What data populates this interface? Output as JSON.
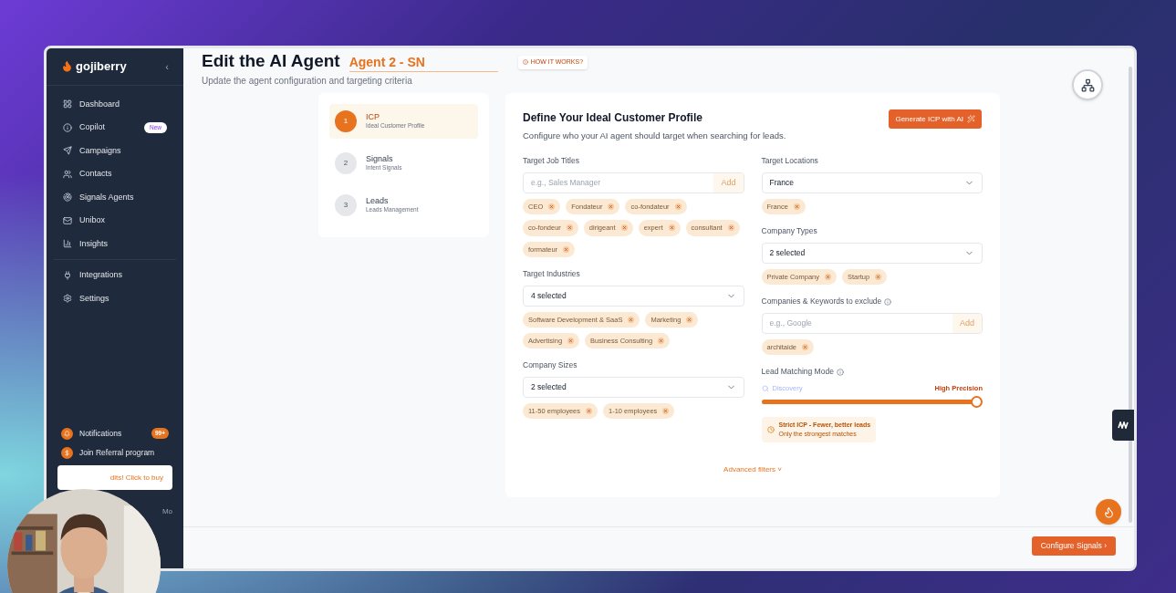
{
  "sidebar": {
    "brand": "gojiberry",
    "collapse": "‹",
    "items": [
      {
        "label": "Dashboard",
        "selected": false
      },
      {
        "label": "Copilot",
        "badge": "New",
        "selected": false
      },
      {
        "label": "Campaigns",
        "selected": false
      },
      {
        "label": "Contacts",
        "selected": false
      },
      {
        "label": "Signals Agents",
        "selected": false
      },
      {
        "label": "Unibox",
        "selected": false
      },
      {
        "label": "Insights",
        "selected": false
      },
      {
        "label": "Integrations",
        "selected": false
      },
      {
        "label": "Settings",
        "selected": false
      }
    ],
    "footer": [
      {
        "label": "Notifications",
        "badge": "99+"
      },
      {
        "label": "Join Referral program"
      }
    ],
    "credits": "dits! Click to buy",
    "user": "Mo"
  },
  "header": {
    "title": "Edit the AI Agent",
    "agent_name": "Agent 2 - SN",
    "help": "HOW IT WORKS?",
    "subtitle": "Update the agent configuration and targeting criteria"
  },
  "steps": [
    {
      "number": "1",
      "title": "ICP",
      "subtitle": "Ideal Customer Profile",
      "selected": true
    },
    {
      "number": "2",
      "title": "Signals",
      "subtitle": "Intent Signals",
      "selected": false
    },
    {
      "number": "3",
      "title": "Leads",
      "subtitle": "Leads Management",
      "selected": false
    }
  ],
  "form": {
    "title": "Define Your Ideal Customer Profile",
    "subtitle": "Configure who your AI agent should target when searching for leads.",
    "generate": "Generate ICP with AI",
    "columns": [
      [
        {
          "kind": "input",
          "label": "Target Job Titles",
          "placeholder": "e.g., Sales Manager",
          "add": "Add",
          "chips": [
            "CEO",
            "Fondateur",
            "co-fondateur",
            "co-fondeur",
            "dirigeant",
            "expert",
            "consultant",
            "formateur"
          ]
        },
        {
          "kind": "select",
          "label": "Target Industries",
          "value": "4 selected",
          "chips": [
            "Software Development & SaaS",
            "Marketing",
            "Advertising",
            "Business Consulting"
          ]
        },
        {
          "kind": "select",
          "label": "Company Sizes",
          "value": "2 selected",
          "chips": [
            "11-50 employees",
            "1-10 employees"
          ]
        }
      ],
      [
        {
          "kind": "select",
          "label": "Target Locations",
          "value": "France",
          "chips": [
            "France"
          ]
        },
        {
          "kind": "select",
          "label": "Company Types",
          "value": "2 selected",
          "chips": [
            "Private Company",
            "Startup"
          ]
        },
        {
          "kind": "input",
          "label": "Companies & Keywords to exclude",
          "info": true,
          "placeholder": "e.g., Google",
          "add": "Add",
          "chips": [
            "architaide"
          ]
        },
        {
          "kind": "slider",
          "label": "Lead Matching Mode",
          "info": true,
          "left": "Discovery",
          "right": "High Precision",
          "level": 1,
          "note_title": "Strict ICP - Fewer, better leads",
          "note_text": "Only the strongest matches"
        }
      ]
    ],
    "advanced": "Advanced filters ˅"
  },
  "footer_button": "Configure Signals ›"
}
